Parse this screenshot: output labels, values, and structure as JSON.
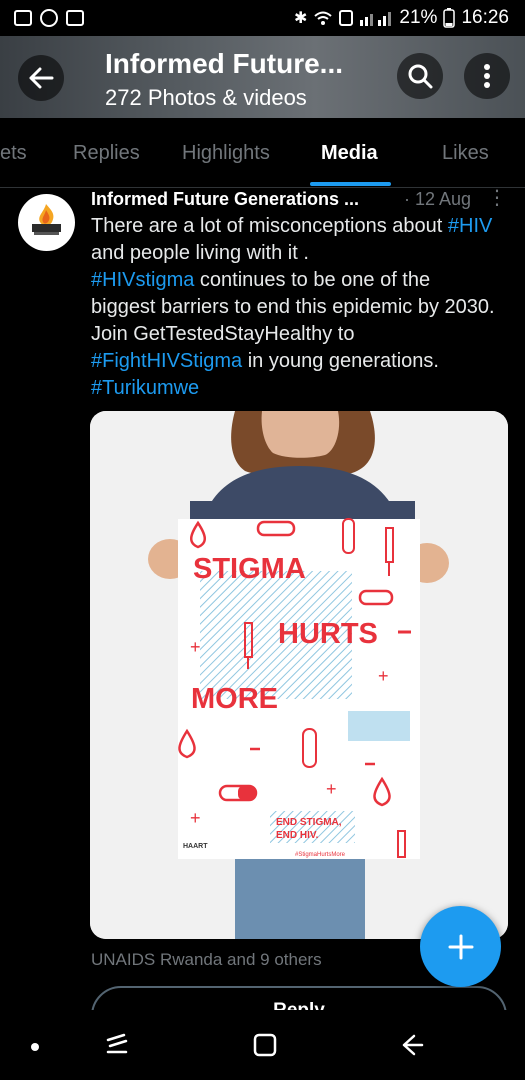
{
  "status_bar": {
    "battery": "21%",
    "time": "16:26",
    "icons": [
      "gallery-icon",
      "whatsapp-icon",
      "news-icon",
      "bluetooth-icon",
      "wifi-icon",
      "nfc-icon",
      "signal-icon",
      "battery-icon"
    ]
  },
  "header": {
    "title": "Informed Future...",
    "subtitle": "272 Photos & videos",
    "icons": {
      "back": "arrow-left-icon",
      "search": "search-icon",
      "more": "more-vertical-icon"
    }
  },
  "tabs": [
    {
      "label": "ets",
      "active": false
    },
    {
      "label": "Replies",
      "active": false
    },
    {
      "label": "Highlights",
      "active": false
    },
    {
      "label": "Media",
      "active": true
    },
    {
      "label": "Likes",
      "active": false
    }
  ],
  "tweet": {
    "author": "Informed Future Generations ...",
    "date": "· 12 Aug",
    "text": {
      "l1a": "There are a lot of misconceptions about ",
      "l1b": "#HIV",
      "l2": "and people living with it .",
      "l3a": "#HIVstigma",
      "l3b": " continues to be one of the",
      "l4": "biggest barriers to end this epidemic by 2030.",
      "l5": "Join GetTestedStayHealthy to",
      "l6a": "#FightHIVStigma",
      "l6b": " in young generations.",
      "l7": "#Turikumwe"
    },
    "poster": {
      "w1": "STIGMA",
      "w2": "HURTS",
      "w3": "MORE",
      "end": "END STIGMA,",
      "end2": "END HIV.",
      "hashtag": "#StigmaHurtsMore",
      "org": "HAART"
    },
    "tagged": "UNAIDS Rwanda and 9 others",
    "reply_label": "Reply"
  },
  "colors": {
    "accent": "#1d9bf0",
    "poster_red": "#e8323c",
    "background": "#000000"
  }
}
